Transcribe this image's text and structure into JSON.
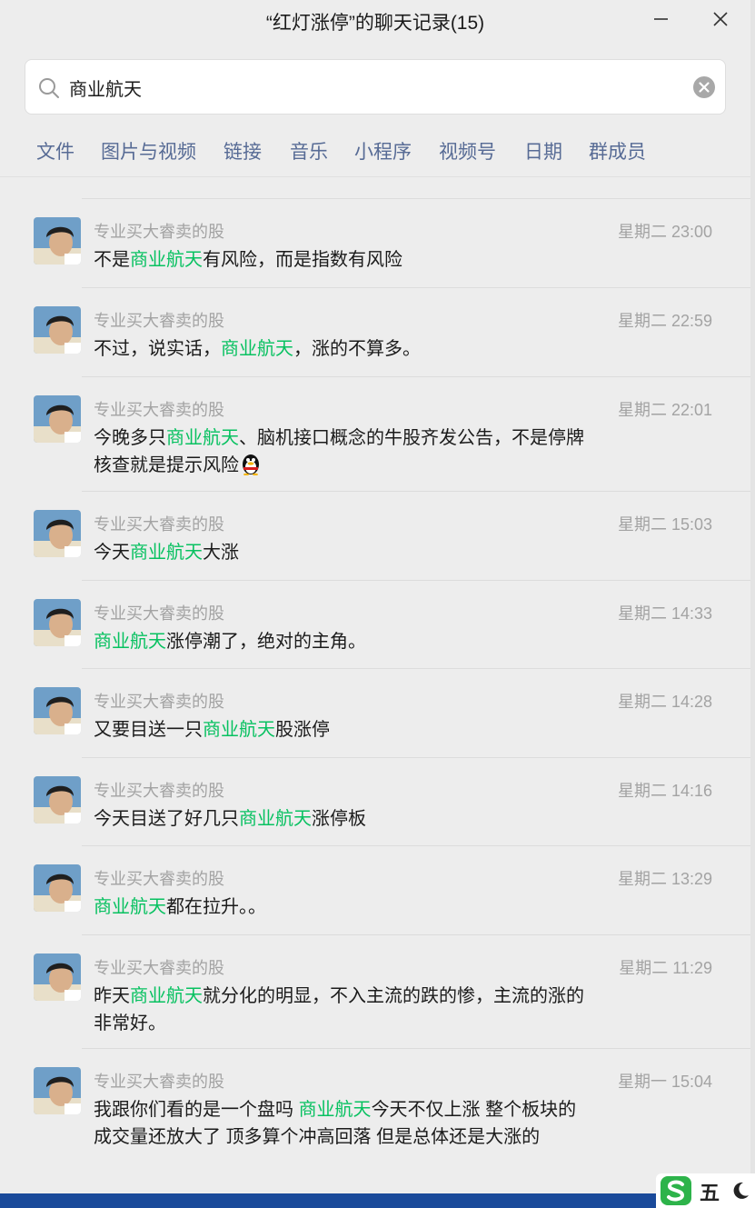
{
  "window": {
    "title": "“红灯涨停”的聊天记录(15)"
  },
  "search": {
    "value": "商业航天",
    "placeholder": "搜索"
  },
  "filters": [
    {
      "label": "文件"
    },
    {
      "label": "图片与视频"
    },
    {
      "label": "链接"
    },
    {
      "label": "音乐"
    },
    {
      "label": "小程序"
    },
    {
      "label": "视频号"
    },
    {
      "label": "日期"
    },
    {
      "label": "群成员"
    }
  ],
  "messages": [
    {
      "sender": "专业买大睿卖的股",
      "time": "星期二 23:00",
      "parts": [
        [
          "不是",
          false
        ],
        [
          "商业航天",
          true
        ],
        [
          "有风险，而是指数有风险",
          false
        ]
      ],
      "emoji": ""
    },
    {
      "sender": "专业买大睿卖的股",
      "time": "星期二 22:59",
      "parts": [
        [
          "不过，说实话，",
          false
        ],
        [
          "商业航天",
          true
        ],
        [
          "，涨的不算多。",
          false
        ]
      ],
      "emoji": ""
    },
    {
      "sender": "专业买大睿卖的股",
      "time": "星期二 22:01",
      "parts": [
        [
          "今晚多只",
          false
        ],
        [
          "商业航天",
          true
        ],
        [
          "、脑机接口概念的牛股齐发公告，不是停牌核查就是提示风险",
          false
        ]
      ],
      "emoji": "penguin-emoji"
    },
    {
      "sender": "专业买大睿卖的股",
      "time": "星期二 15:03",
      "parts": [
        [
          "今天",
          false
        ],
        [
          "商业航天",
          true
        ],
        [
          "大涨",
          false
        ]
      ],
      "emoji": ""
    },
    {
      "sender": "专业买大睿卖的股",
      "time": "星期二 14:33",
      "parts": [
        [
          "商业航天",
          true
        ],
        [
          "涨停潮了，绝对的主角。",
          false
        ]
      ],
      "emoji": ""
    },
    {
      "sender": "专业买大睿卖的股",
      "time": "星期二 14:28",
      "parts": [
        [
          "又要目送一只",
          false
        ],
        [
          "商业航天",
          true
        ],
        [
          "股涨停",
          false
        ]
      ],
      "emoji": ""
    },
    {
      "sender": "专业买大睿卖的股",
      "time": "星期二 14:16",
      "parts": [
        [
          "今天目送了好几只",
          false
        ],
        [
          "商业航天",
          true
        ],
        [
          "涨停板",
          false
        ]
      ],
      "emoji": ""
    },
    {
      "sender": "专业买大睿卖的股",
      "time": "星期二 13:29",
      "parts": [
        [
          "商业航天",
          true
        ],
        [
          "都在拉升。。",
          false
        ]
      ],
      "emoji": ""
    },
    {
      "sender": "专业买大睿卖的股",
      "time": "星期二 11:29",
      "parts": [
        [
          "昨天",
          false
        ],
        [
          "商业航天",
          true
        ],
        [
          "就分化的明显，不入主流的跌的惨，主流的涨的非常好。",
          false
        ]
      ],
      "emoji": ""
    },
    {
      "sender": "专业买大睿卖的股",
      "time": "星期一 15:04",
      "parts": [
        [
          "我跟你们看的是一个盘吗  ",
          false
        ],
        [
          "商业航天",
          true
        ],
        [
          "今天不仅上涨  整个板块的成交量还放大了  顶多算个冲高回落  但是总体还是大涨的",
          false
        ]
      ],
      "emoji": ""
    }
  ],
  "ime": {
    "mode": "五"
  },
  "colors": {
    "highlight": "#07c160",
    "filter_text": "#576b95",
    "meta_text": "#a3a3a3",
    "background": "#ededed"
  }
}
